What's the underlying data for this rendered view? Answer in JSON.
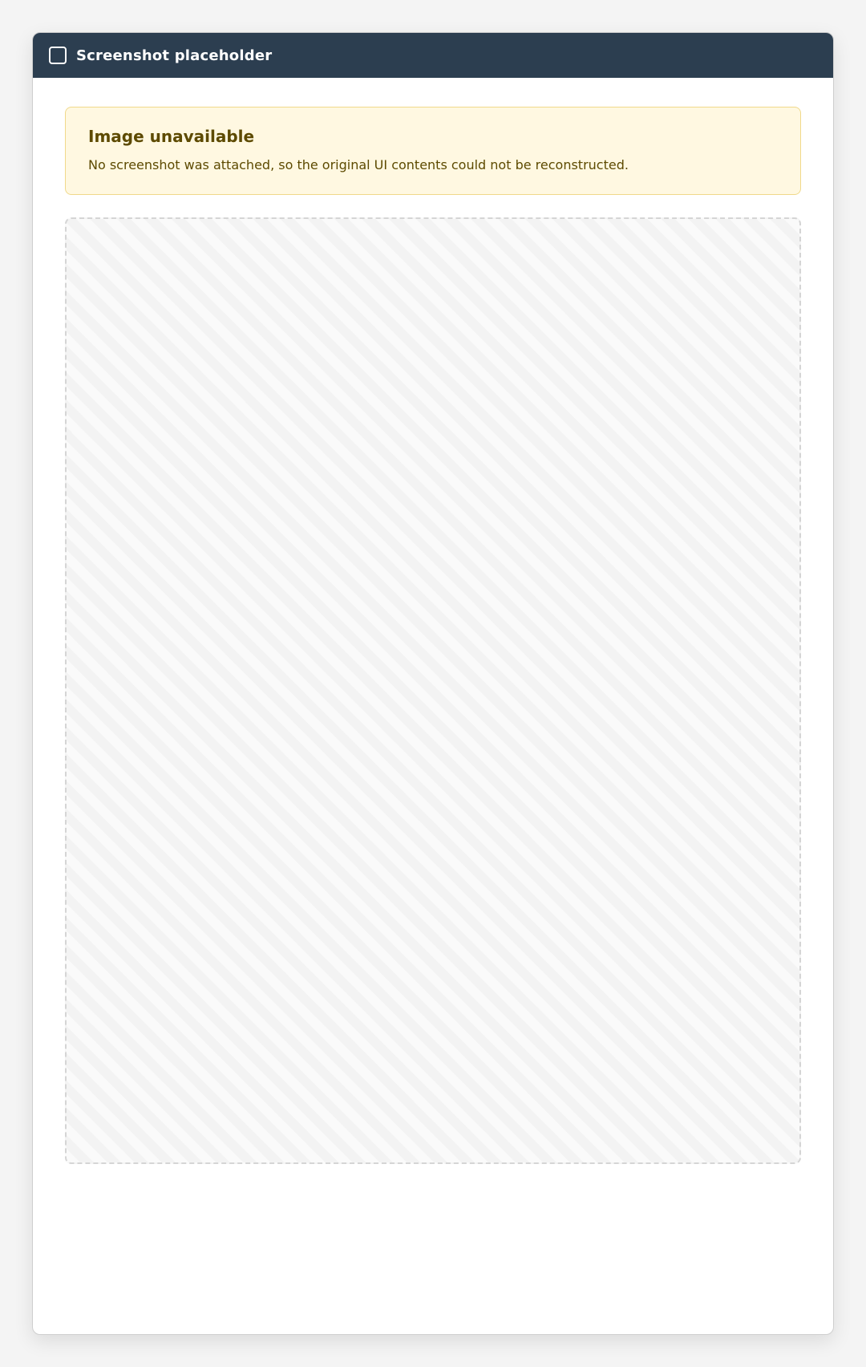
{
  "window": {
    "title": "Screenshot placeholder"
  },
  "notice": {
    "heading": "Image unavailable",
    "body": "No screenshot was attached, so the original UI contents could not be reconstructed."
  }
}
